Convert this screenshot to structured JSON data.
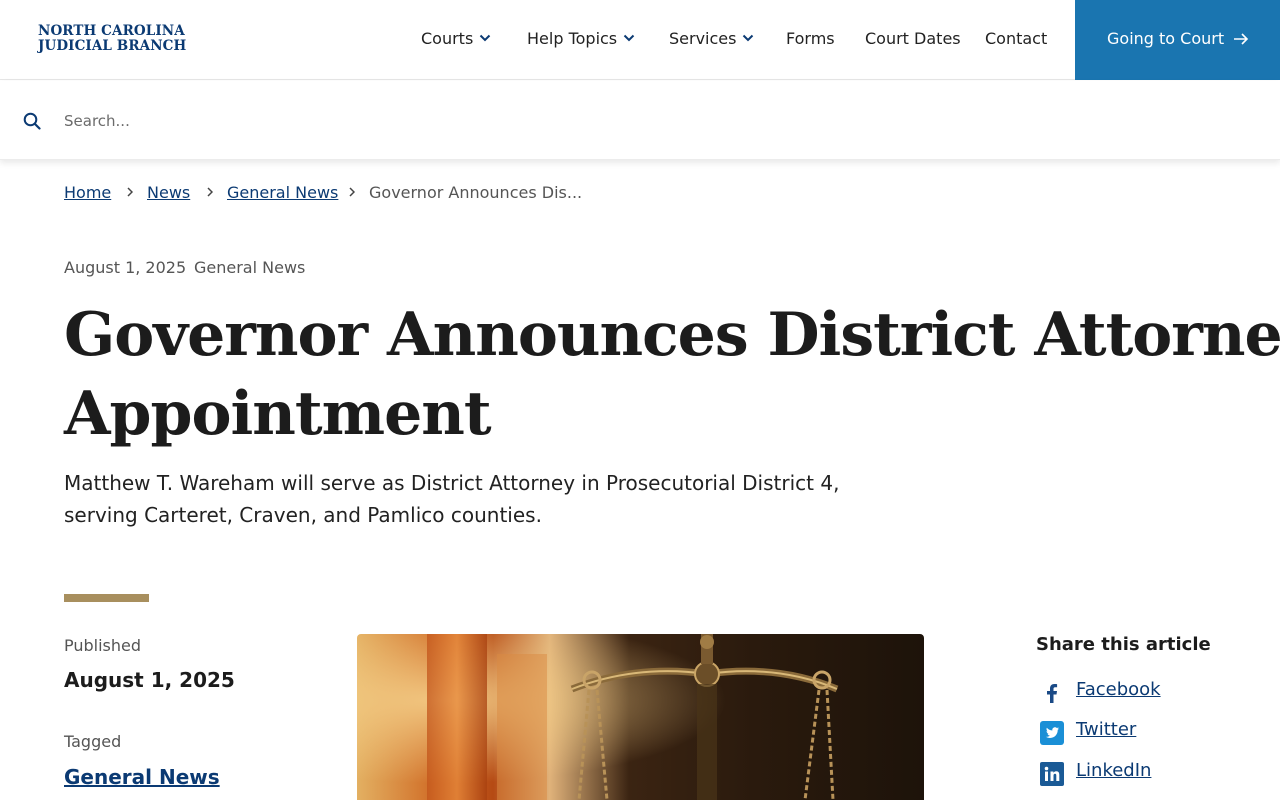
{
  "site": {
    "logo_line1": "NORTH CAROLINA",
    "logo_line2": "JUDICIAL BRANCH"
  },
  "nav": {
    "items": [
      {
        "label": "Courts",
        "dropdown": true
      },
      {
        "label": "Help Topics",
        "dropdown": true
      },
      {
        "label": "Services",
        "dropdown": true
      },
      {
        "label": "Forms",
        "dropdown": false
      },
      {
        "label": "Court Dates",
        "dropdown": false
      },
      {
        "label": "Contact",
        "dropdown": false
      }
    ],
    "cta_label": "Going to Court"
  },
  "search": {
    "placeholder": "Search..."
  },
  "breadcrumb": {
    "items": [
      "Home",
      "News",
      "General News"
    ],
    "current": "Governor Announces Dis..."
  },
  "article": {
    "date": "August 1, 2025",
    "category": "General News",
    "title_line1": "Governor Announces District Attorney",
    "title_line2": "Appointment",
    "lede_line1": "Matthew T. Wareham will serve as District Attorney in Prosecutorial District 4,",
    "lede_line2": "serving Carteret, Craven, and Pamlico counties."
  },
  "sidebar": {
    "published_label": "Published",
    "published_value": "August 1, 2025",
    "tagged_label": "Tagged",
    "tag": "General News"
  },
  "share": {
    "title": "Share this article",
    "items": [
      "Facebook",
      "Twitter",
      "LinkedIn"
    ]
  },
  "colors": {
    "brand_navy": "#0b3a73",
    "cta_blue": "#1a75b0",
    "accent_gold": "#a88f5e"
  }
}
